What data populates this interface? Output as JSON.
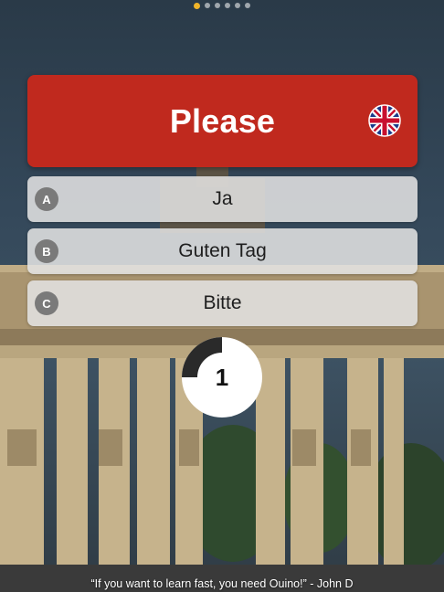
{
  "pager": {
    "total": 6,
    "active_index": 0
  },
  "prompt": {
    "word": "Please",
    "flag_icon": "uk-flag-icon",
    "card_color": "#c0291e"
  },
  "answers": [
    {
      "letter": "A",
      "text": "Ja"
    },
    {
      "letter": "B",
      "text": "Guten Tag"
    },
    {
      "letter": "C",
      "text": "Bitte"
    }
  ],
  "timer": {
    "seconds": "1",
    "elapsed_fraction": 0.25
  },
  "quote": "“If you want to learn fast, you need Ouino!” - John D"
}
